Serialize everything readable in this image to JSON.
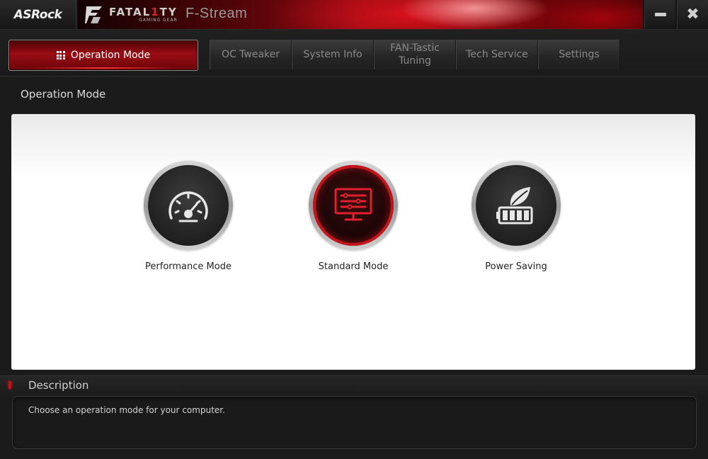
{
  "window": {
    "brand": "ASRock",
    "product_logo": "FATAL1TY",
    "product_logo_sub": "GAMING GEAR",
    "title": "F-Stream",
    "minimize_icon": "minimize-icon",
    "close_icon": "close-icon",
    "close_glyph": "✖"
  },
  "nav": {
    "active": {
      "label": "Operation Mode",
      "icon": "grid-icon"
    },
    "tabs": [
      {
        "label": "OC Tweaker"
      },
      {
        "label": "System Info"
      },
      {
        "label_line1": "FAN-Tastic",
        "label_line2": "Tuning"
      },
      {
        "label": "Tech Service"
      },
      {
        "label": "Settings"
      }
    ]
  },
  "section": {
    "title": "Operation Mode"
  },
  "modes": [
    {
      "label": "Performance Mode",
      "icon": "speedometer-icon",
      "selected": false
    },
    {
      "label": "Standard Mode",
      "icon": "monitor-icon",
      "selected": true
    },
    {
      "label": "Power Saving",
      "icon": "leaf-battery-icon",
      "selected": false
    }
  ],
  "description": {
    "title": "Description",
    "text": "Choose an operation mode for your computer."
  },
  "colors": {
    "accent_red": "#c4141c",
    "panel_bg": "#ffffff",
    "app_bg": "#1b1b1b"
  }
}
